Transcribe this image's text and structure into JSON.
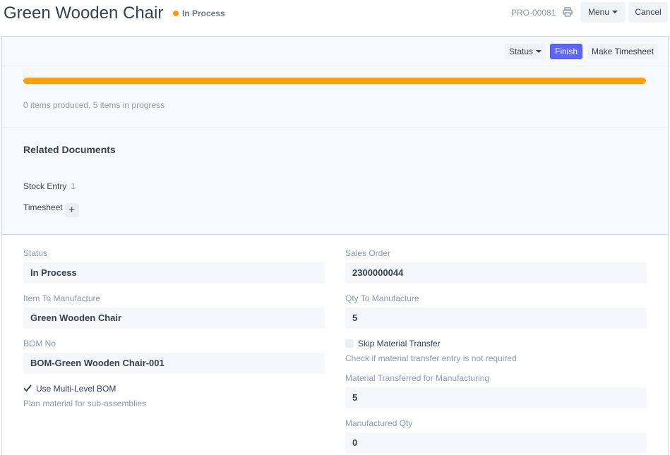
{
  "header": {
    "title": "Green Wooden Chair",
    "status": "In Process",
    "status_color": "#ff9800",
    "docname": "PRO-00081",
    "print_icon": "printer-icon",
    "menu_label": "Menu",
    "cancel_label": "Cancel"
  },
  "toolbar": {
    "status_label": "Status",
    "finish_label": "Finish",
    "make_timesheet_label": "Make Timesheet",
    "primary_color": "#5e64ff"
  },
  "progress": {
    "produced_fraction": 0.0,
    "in_progress_fraction": 1.0,
    "produced_color": "#98d85b",
    "in_progress_color": "#ffa00a",
    "summary": "0 items produced. 5 items in progress"
  },
  "related": {
    "title": "Related Documents",
    "items": [
      {
        "label": "Stock Entry",
        "count": "1"
      },
      {
        "label": "Timesheet",
        "action": "+"
      }
    ]
  },
  "fields": {
    "status": {
      "label": "Status",
      "value": "In Process"
    },
    "item": {
      "label": "Item To Manufacture",
      "value": "Green Wooden Chair"
    },
    "bom": {
      "label": "BOM No",
      "value": "BOM-Green Wooden Chair-001"
    },
    "multi_level_bom": {
      "label": "Use Multi-Level BOM",
      "checked": true,
      "description": "Plan material for sub-assemblies"
    },
    "sales_order": {
      "label": "Sales Order",
      "value": "2300000044"
    },
    "qty": {
      "label": "Qty To Manufacture",
      "value": "5"
    },
    "skip_transfer": {
      "label": "Skip Material Transfer",
      "checked": false,
      "description": "Check if material transfer entry is not required"
    },
    "material_transferred": {
      "label": "Material Transferred for Manufacturing",
      "value": "5"
    },
    "manufactured_qty": {
      "label": "Manufactured Qty",
      "value": "0"
    }
  }
}
